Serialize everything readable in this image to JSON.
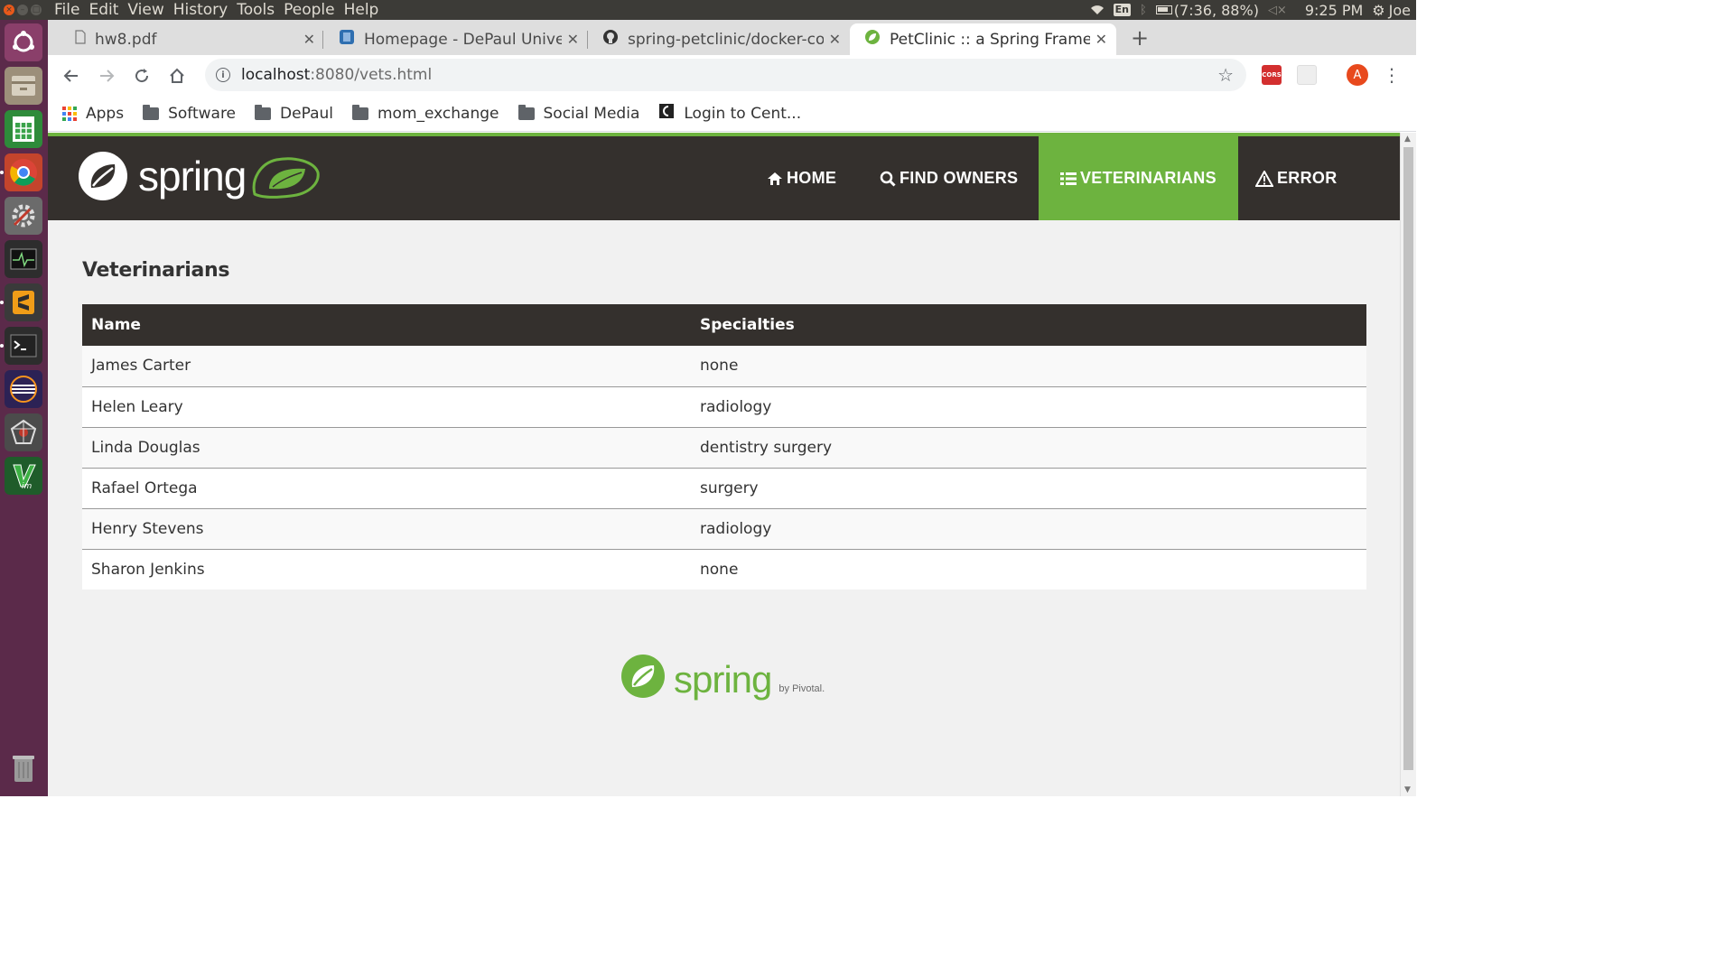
{
  "os": {
    "menus": [
      "File",
      "Edit",
      "View",
      "History",
      "Tools",
      "People",
      "Help"
    ],
    "input_lang": "En",
    "battery": "(7:36, 88%)",
    "clock": "9:25 PM",
    "user": "Joe"
  },
  "browser": {
    "tabs": [
      {
        "title": "hw8.pdf",
        "active": false
      },
      {
        "title": "Homepage - DePaul University",
        "active": false
      },
      {
        "title": "spring-petclinic/docker-compose",
        "active": false
      },
      {
        "title": "PetClinic :: a Spring Framework",
        "active": true
      }
    ],
    "url_host": "localhost",
    "url_path": ":8080/vets.html",
    "extensions": {
      "cors_label": "CORS",
      "avatar_letter": "A"
    },
    "bookmarks": [
      "Apps",
      "Software",
      "DePaul",
      "mom_exchange",
      "Social Media",
      "Login to Cent..."
    ]
  },
  "page": {
    "logo_text": "spring",
    "nav": [
      {
        "label": "HOME",
        "icon": "home-icon"
      },
      {
        "label": "FIND OWNERS",
        "icon": "search-icon"
      },
      {
        "label": "VETERINARIANS",
        "icon": "list-icon",
        "active": true
      },
      {
        "label": "ERROR",
        "icon": "warning-icon"
      }
    ],
    "title": "Veterinarians",
    "table": {
      "headers": [
        "Name",
        "Specialties"
      ],
      "rows": [
        {
          "name": "James Carter",
          "specialties": "none"
        },
        {
          "name": "Helen Leary",
          "specialties": "radiology"
        },
        {
          "name": "Linda Douglas",
          "specialties": "dentistry surgery"
        },
        {
          "name": "Rafael Ortega",
          "specialties": "surgery"
        },
        {
          "name": "Henry Stevens",
          "specialties": "radiology"
        },
        {
          "name": "Sharon Jenkins",
          "specialties": "none"
        }
      ]
    },
    "footer": {
      "logo_text": "spring",
      "by_text": "by Pivotal."
    }
  },
  "colors": {
    "spring_green": "#6db33f",
    "nav_dark": "#34302d",
    "launcher_purple": "#5b2a4a"
  }
}
